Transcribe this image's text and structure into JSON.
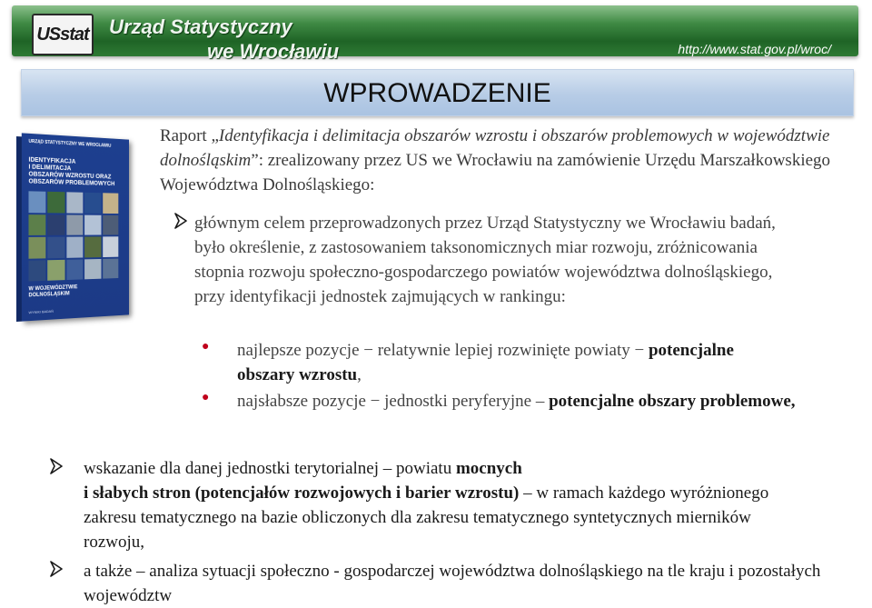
{
  "header": {
    "logo_text": "USstat",
    "title_line1": "Urząd Statystyczny",
    "title_line2": "we Wrocławiu",
    "url": "http://www.stat.gov.pl/wroc/"
  },
  "title": "WPROWADZENIE",
  "book": {
    "header": "URZĄD STATYSTYCZNY WE WROCŁAWIU",
    "title": "IDENTYFIKACJA\nI DELIMITACJA\nOBSZARÓW WZROSTU ORAZ\nOBSZARÓW PROBLEMOWYCH",
    "footer": "W WOJEWÓDZTWIE\nDOLNOŚLĄSKIM",
    "subtitle": "WYNIKI BADAŃ",
    "mosaic_colors": [
      "#6a8fbf",
      "#3d6a3a",
      "#a9b7c8",
      "#274d8f",
      "#c4b28a",
      "#5c7f4a",
      "#2b3f6f",
      "#8e9aa9",
      "#b3c2d6",
      "#4d5d77",
      "#7a8f5b",
      "#33508a",
      "#9fb0c7",
      "#566c3f",
      "#c8d0db",
      "#2d4a7e",
      "#8aa06b",
      "#3f5f9a",
      "#a6b5c3",
      "#5b7396"
    ]
  },
  "intro": {
    "prefix": "Raport „",
    "report_title": "Identyfikacja i delimitacja obszarów wzrostu i obszarów problemowych w województwie dolnośląskim",
    "suffix": "”: zrealizowany   przez US we Wrocławiu na zamówienie Urzędu Marszałkowskiego Województwa Dolnośląskiego:"
  },
  "point1": {
    "text": "głównym celem przeprowadzonych przez Urząd Statystyczny we Wrocławiu badań, było  określenie, z zastosowaniem taksonomicznych miar rozwoju,  zróżnicowania stopnia rozwoju społeczno-gospodarczego powiatów województwa dolnośląskiego, przy identyfikacji jednostek zajmujących w rankingu:",
    "sub1_pre": "najlepsze pozycje − relatywnie lepiej rozwinięte powiaty −",
    "sub1_bold": "potencjalne obszary wzrostu",
    "sub1_post": ",",
    "sub2_pre": "najsłabsze pozycje − jednostki peryferyjne –",
    "sub2_bold": "potencjalne obszary problemowe,"
  },
  "point2": {
    "pre": "wskazanie dla danej jednostki terytorialnej – powiatu",
    "bold1": "mocnych",
    "bold2": "i słabych stron (potencjałów rozwojowych i barier wzrostu)",
    "post": "– w ramach każdego wyróżnionego zakresu tematycznego na bazie obliczonych dla zakresu tematycznego syntetycznych mierników rozwoju,"
  },
  "point3": {
    "text": "a także – analiza sytuacji społeczno - gospodarczej województwa dolnośląskiego na tle kraju i pozostałych województw"
  },
  "colors": {
    "arrow": "#1a1a1a",
    "bullet": "#c0001b",
    "banner_green": "#1f6426",
    "title_blue": "#b7cce6"
  }
}
